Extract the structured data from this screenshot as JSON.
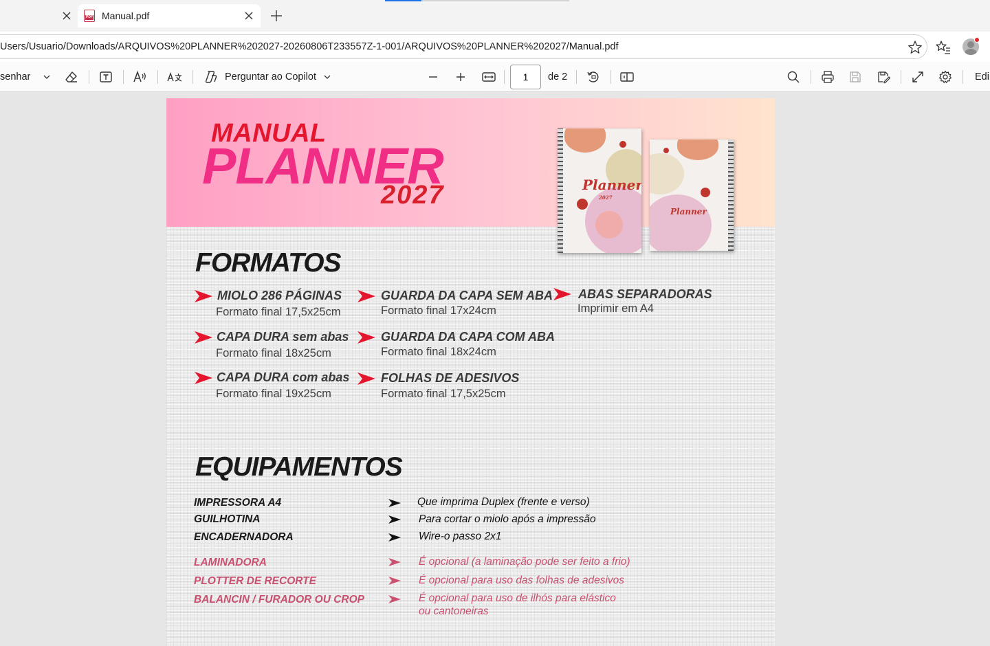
{
  "tabs": {
    "active_title": "Manual.pdf",
    "favicon_text": "PDF"
  },
  "address": {
    "url": "Users/Usuario/Downloads/ARQUIVOS%20PLANNER%202027-20260806T233557Z-1-001/ARQUIVOS%20PLANNER%202027/Manual.pdf"
  },
  "toolbar": {
    "draw_label": "senhar",
    "copilot_label": "Perguntar ao Copilot",
    "page_current": "1",
    "page_total": "de 2",
    "edit_label": "Edi"
  },
  "doc": {
    "title_manual": "MANUAL",
    "title_planner": "PLANNER",
    "title_year": "2027",
    "cover_script": "Planner",
    "cover_year": "2027",
    "formats_heading": "FORMATOS",
    "formats": [
      {
        "title": "MIOLO 286 PÁGINAS",
        "sub": "Formato final 17,5x25cm"
      },
      {
        "title": "CAPA DURA sem abas",
        "sub": "Formato final 18x25cm"
      },
      {
        "title": "CAPA DURA com abas",
        "sub": "Formato final 19x25cm"
      },
      {
        "title": "GUARDA DA CAPA SEM ABA",
        "sub": "Formato final 17x24cm"
      },
      {
        "title": "GUARDA DA CAPA COM ABA",
        "sub": "Formato final 18x24cm"
      },
      {
        "title": "FOLHAS DE ADESIVOS",
        "sub": "Formato final 17,5x25cm"
      },
      {
        "title": "ABAS SEPARADORAS",
        "sub": "Imprimir em A4"
      }
    ],
    "equip_heading": "EQUIPAMENTOS",
    "equipment": [
      {
        "label": "IMPRESSORA A4",
        "desc": "Que imprima Duplex (frente e verso)"
      },
      {
        "label": "GUILHOTINA",
        "desc": "Para cortar o miolo após a impressão"
      },
      {
        "label": "ENCADERNADORA",
        "desc": "Wire-o passo 2x1"
      },
      {
        "label": "LAMINADORA",
        "desc": "É opcional (a laminação pode ser feito a frio)"
      },
      {
        "label": "PLOTTER DE RECORTE",
        "desc": "É opcional para uso das folhas de adesivos"
      },
      {
        "label": "BALANCIN / FURADOR OU CROP",
        "desc": "É opcional para uso de ilhós para elástico",
        "desc2": "ou cantoneiras"
      }
    ]
  },
  "colors": {
    "accent_red": "#e3162e",
    "planner_pink": "#f02e86",
    "optional_pink": "#c9506f"
  }
}
